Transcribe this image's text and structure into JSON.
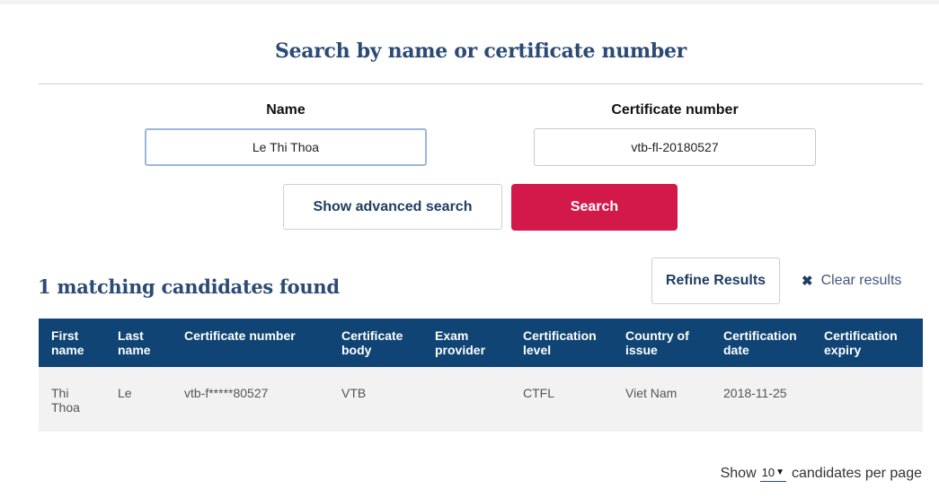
{
  "search": {
    "heading": "Search by name or certificate number",
    "name_label": "Name",
    "name_value": "Le Thi Thoa",
    "cert_label": "Certificate number",
    "cert_value": "vtb-fl-20180527",
    "advanced_button": "Show advanced search",
    "search_button": "Search"
  },
  "results": {
    "title": "1 matching candidates found",
    "refine_button": "Refine Results",
    "clear_label": "Clear results",
    "clear_icon": "close-icon",
    "columns": [
      "First\nname",
      "Last\nname",
      "Certificate number",
      "Certificate\nbody",
      "Exam\nprovider",
      "Certification\nlevel",
      "Country of\nissue",
      "Certification\ndate",
      "Certification\nexpiry"
    ],
    "rows": [
      {
        "first_name": "Thi\nThoa",
        "last_name": "Le",
        "certificate_number": "vtb-f*****80527",
        "certificate_body": "VTB",
        "exam_provider": "",
        "certification_level": "CTFL",
        "country_of_issue": "Viet Nam",
        "certification_date": "2018-11-25",
        "certification_expiry": ""
      }
    ]
  },
  "pagination": {
    "show_label": "Show",
    "per_page_value": "10",
    "per_page_suffix": "candidates per page"
  },
  "colors": {
    "heading": "#2b4a75",
    "table_header": "#0f4475",
    "search_button": "#d2194a",
    "row_background": "#f2f2f2"
  }
}
